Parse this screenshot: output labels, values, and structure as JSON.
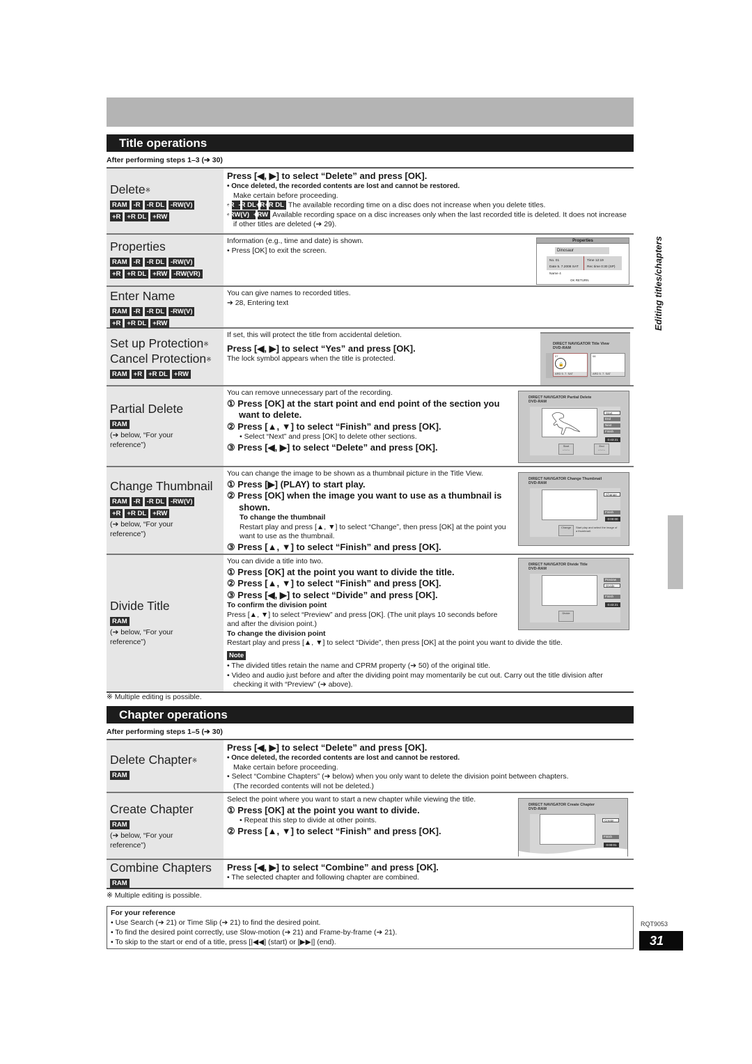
{
  "title_section": {
    "heading": "Title operations",
    "after_steps": "After performing steps 1–3 (➔ 30)",
    "rows": {
      "delete": {
        "title": "Delete",
        "mark": "※",
        "badges_line1": [
          "RAM",
          "-R",
          "-R DL",
          "-RW(V)"
        ],
        "badges_line2": [
          "+R",
          "+R DL",
          "+RW"
        ],
        "step": "Press [◀, ▶] to select “Delete” and press [OK].",
        "bullet1_bold": "• Once deleted, the recorded contents are lost and cannot be restored.",
        "bullet1_sub": "Make certain before proceeding.",
        "bullet2_badges": [
          "-R",
          "-R DL",
          "+R",
          "+R DL"
        ],
        "bullet2_text": "The available recording time on a disc does not increase when you delete titles.",
        "bullet3_badges": [
          "-RW(V)",
          "+RW"
        ],
        "bullet3_text": "Available recording space on a disc increases only when the last recorded title is deleted. It does not increase if other titles are deleted (➔ 29)."
      },
      "properties": {
        "title": "Properties",
        "badges_line1": [
          "RAM",
          "-R",
          "-R DL",
          "-RW(V)"
        ],
        "badges_line2": [
          "+R",
          "+R DL",
          "+RW",
          "-RW(VR)"
        ],
        "text1": "Information (e.g., time and date) is shown.",
        "text2": "• Press [OK] to exit the screen.",
        "screen": {
          "header": "Properties",
          "name": "Dinosaur",
          "no": "No.   01",
          "date": "Date  5. 7.2008 SAT",
          "name_label": "Name 4",
          "time": "Time       12:19",
          "rec_time": "Rec time  0:30 (SP)",
          "footer": "OK  RETURN"
        }
      },
      "enter_name": {
        "title": "Enter Name",
        "badges_line1": [
          "RAM",
          "-R",
          "-R DL",
          "-RW(V)"
        ],
        "badges_line2": [
          "+R",
          "+R DL",
          "+RW"
        ],
        "text1": "You can give names to recorded titles.",
        "text2": "➔ 28, Entering text"
      },
      "protection": {
        "title1": "Set up Protection",
        "title2": "Cancel Protection",
        "mark": "※",
        "badges_line1": [
          "RAM",
          "+R",
          "+R DL",
          "+RW"
        ],
        "text1": "If set, this will protect the title from accidental deletion.",
        "step": "Press [◀, ▶] to select “Yes” and press [OK].",
        "text2": "The lock symbol appears when the title is protected.",
        "screen": {
          "header": "DIRECT NAVIGATOR   Title View",
          "disc": "DVD-RAM",
          "thumb1_no": "07",
          "thumb1_label": "ARD    5. 7. SAT",
          "thumb2_no": "08",
          "thumb2_label": "ARD    5. 7. SAT"
        }
      },
      "partial_delete": {
        "title": "Partial Delete",
        "badges_line1": [
          "RAM"
        ],
        "ref": "(➔ below, “For your reference”)",
        "intro": "You can remove unnecessary part of the recording.",
        "step1": "① Press [OK] at the start point and end point of the section you want to delete.",
        "step2": "② Press [▲, ▼] to select “Finish” and press [OK].",
        "step2_bullet": "• Select “Next” and press [OK] to delete other sections.",
        "step3": "③ Press [◀, ▶] to select “Delete” and press [OK].",
        "screen": {
          "header": "DIRECT NAVIGATOR   Partial Delete",
          "disc": "DVD-RAM",
          "play": "PLAY",
          "buttons": [
            "Start",
            "End",
            "Next",
            "Finish"
          ],
          "time": "0:43:21",
          "start": "Start",
          "end": "End",
          "blank": "--:--:--"
        }
      },
      "change_thumbnail": {
        "title": "Change Thumbnail",
        "badges_line1": [
          "RAM",
          "-R",
          "-R DL",
          "-RW(V)"
        ],
        "badges_line2": [
          "+R",
          "+R DL",
          "+RW"
        ],
        "ref": "(➔ below, “For your reference”)",
        "intro": "You can change the image to be shown as a thumbnail picture in the Title View.",
        "step1": "① Press [▶] (PLAY) to start play.",
        "step2": "② Press [OK] when the image you want to use as a thumbnail is shown.",
        "sub_head": "To change the thumbnail",
        "sub_text": "Restart play and press [▲, ▼] to select “Change”, then press [OK] at the point you want to use as the thumbnail.",
        "step3": "③ Press [▲, ▼] to select “Finish” and press [OK].",
        "screen": {
          "header": "DIRECT NAVIGATOR   Change Thumbnail",
          "disc": "DVD-RAM",
          "buttons": [
            "Change",
            "Finish"
          ],
          "time": "0:00:00",
          "change": "Change",
          "hint": "Start play and select the image of a thumbnail."
        }
      },
      "divide_title": {
        "title": "Divide Title",
        "badges_line1": [
          "RAM"
        ],
        "ref": "(➔ below, “For your reference”)",
        "intro": "You can divide a title into two.",
        "step1": "① Press [OK] at the point you want to divide the title.",
        "step2": "② Press [▲, ▼] to select “Finish” and press [OK].",
        "step3": "③ Press [◀, ▶] to select “Divide” and press [OK].",
        "sub1_head": "To confirm the division point",
        "sub1_text": "Press [▲, ▼] to select “Preview” and press [OK]. (The unit plays 10 seconds before and after the division point.)",
        "sub2_head": "To change the division point",
        "sub2_text": "Restart play and press [▲, ▼] to select “Divide”, then press [OK] at the point you want to divide the title.",
        "note_label": "Note",
        "note1": "• The divided titles retain the name and CPRM property (➔ 50) of the original title.",
        "note2": "• Video and audio just before and after the dividing point may momentarily be cut out. Carry out the title division after checking it with “Preview” (➔ above).",
        "screen": {
          "header": "DIRECT NAVIGATOR   Divide Title",
          "disc": "DVD-RAM",
          "play": "PLAY",
          "buttons": [
            "Preview",
            "Divide",
            "Finish"
          ],
          "time": "0:43:21",
          "divide": "Divide"
        }
      }
    },
    "footnote": "※ Multiple editing is possible."
  },
  "chapter_section": {
    "heading": "Chapter operations",
    "after_steps": "After performing steps 1–5 (➔ 30)",
    "rows": {
      "delete_chapter": {
        "title": "Delete Chapter",
        "mark": "※",
        "badges_line1": [
          "RAM"
        ],
        "step": "Press [◀, ▶] to select “Delete” and press [OK].",
        "bullet1_bold": "• Once deleted, the recorded contents are lost and cannot be restored.",
        "bullet1_sub": "Make certain before proceeding.",
        "bullet2": "• Select “Combine Chapters” (➔ below) when you only want to delete the division point between chapters.",
        "bullet2_sub": "(The recorded contents will not be deleted.)"
      },
      "create_chapter": {
        "title": "Create Chapter",
        "badges_line1": [
          "RAM"
        ],
        "ref": "(➔ below, “For your reference”)",
        "intro": "Select the point where you want to start a new chapter while viewing the title.",
        "step1": "① Press [OK] at the point you want to divide.",
        "step1_bullet": "• Repeat this step to divide at other points.",
        "step2": "② Press [▲, ▼] to select “Finish” and press [OK].",
        "screen": {
          "header": "DIRECT NAVIGATOR   Create Chapter",
          "disc": "DVD-RAM",
          "play": "PLAY",
          "buttons": [
            "Create",
            "Finish"
          ],
          "time": "0:00:01"
        }
      },
      "combine_chapters": {
        "title": "Combine Chapters",
        "badges_line1": [
          "RAM"
        ],
        "step": "Press [◀, ▶] to select “Combine” and press [OK].",
        "bullet": "• The selected chapter and following chapter are combined."
      }
    },
    "footnote": "※ Multiple editing is possible."
  },
  "reference": {
    "heading": "For your reference",
    "items": [
      "• Use Search (➔ 21) or Time Slip (➔ 21) to find the desired point.",
      "• To find the desired point correctly, use Slow-motion (➔ 21) and Frame-by-frame (➔ 21).",
      "• To skip to the start or end of a title, press [|◀◀] (start) or [▶▶|] (end)."
    ]
  },
  "side_tab": "Editing titles/chapters",
  "doc_code": "RQT9053",
  "page_number": "31"
}
